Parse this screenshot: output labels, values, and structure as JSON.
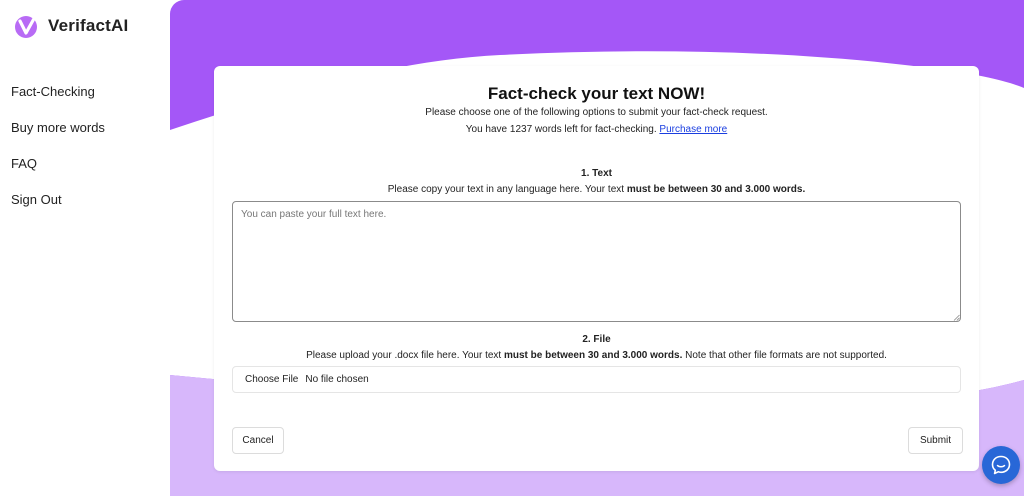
{
  "brand": {
    "name": "VerifactAI",
    "logo_icon": "verifactai-logo-icon",
    "accent": "#a457f7"
  },
  "sidebar": {
    "items": [
      {
        "label": "Fact-Checking"
      },
      {
        "label": "Buy more words"
      },
      {
        "label": "FAQ"
      },
      {
        "label": "Sign Out"
      }
    ]
  },
  "card": {
    "title": "Fact-check your text NOW!",
    "subtitle": "Please choose one of the following options to submit your fact-check request.",
    "words_prefix": "You have ",
    "words_count": "1237",
    "words_suffix": " words left for fact-checking. ",
    "purchase_link": "Purchase more",
    "text_section": {
      "title": "1. Text",
      "desc_plain": "Please copy your text in any language here. Your text ",
      "desc_bold": "must be between 30 and 3.000 words.",
      "placeholder": "You can paste your full text here."
    },
    "file_section": {
      "title": "2. File",
      "desc_plain": "Please upload your .docx file here. Your text ",
      "desc_bold": "must be between 30 and 3.000 words.",
      "desc_after": " Note that other file formats are not supported.",
      "choose_button": "Choose File",
      "status": "No file chosen"
    },
    "cancel_button": "Cancel",
    "submit_button": "Submit"
  },
  "chat": {
    "icon": "chat-bubble-icon",
    "color": "#2867d7"
  }
}
